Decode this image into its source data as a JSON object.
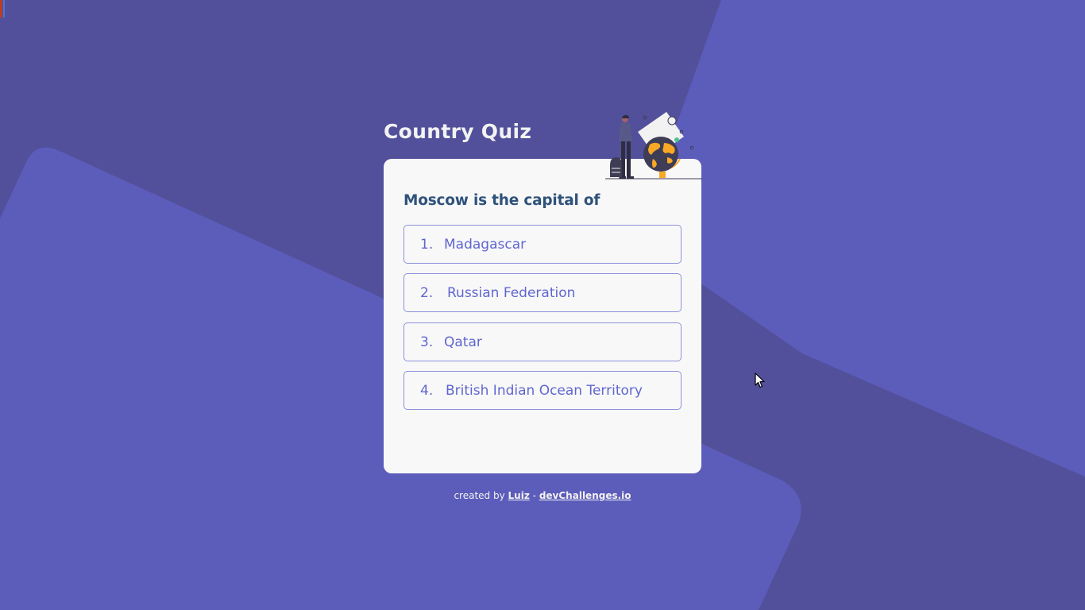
{
  "app": {
    "title": "Country Quiz"
  },
  "quiz": {
    "question": "Moscow is the capital of",
    "options": [
      {
        "number": "1.",
        "label": "Madagascar"
      },
      {
        "number": "2.",
        "label": "Russian Federation"
      },
      {
        "number": "3.",
        "label": "Qatar"
      },
      {
        "number": "4.",
        "label": "British Indian Ocean Territory"
      }
    ]
  },
  "footer": {
    "prefix": "created by",
    "author": "Luiz",
    "separator": "-",
    "site": "devChallenges.io"
  },
  "icons": {
    "illustration": "traveler-globe-illustration",
    "cursor": "mouse-pointer-icon"
  },
  "colors": {
    "background": "#52509a",
    "shape": "#5c5cbb",
    "card": "#f8f8f8",
    "title": "#f2f2f2",
    "question": "#2f527b",
    "option": "#6066d0",
    "accent": "#f9a826"
  }
}
